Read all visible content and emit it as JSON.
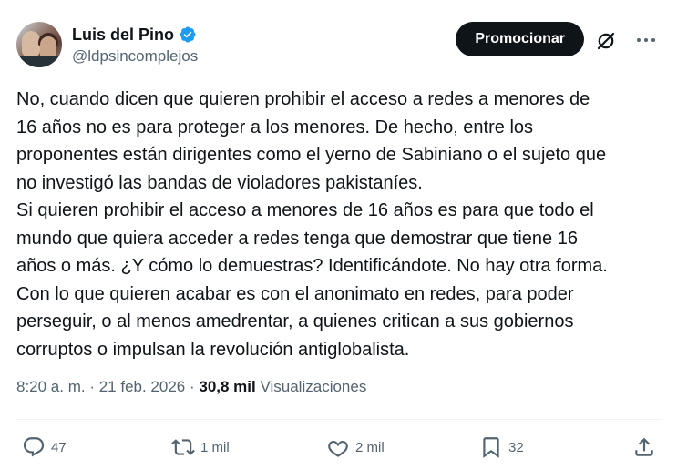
{
  "author": {
    "display_name": "Luis del Pino",
    "handle": "@ldpsincomplejos",
    "verified": true
  },
  "header": {
    "promote_label": "Promocionar",
    "grok_icon": "grok-icon",
    "more_icon": "more-dots-icon"
  },
  "tweet": {
    "paragraph_1": "No, cuando dicen que quieren prohibir el acceso a redes a menores de\n16 años no es para proteger a los menores. De hecho, entre los\nproponentes están dirigentes como el yerno de Sabiniano o el sujeto que\nno investigó las bandas de violadores pakistaníes.",
    "paragraph_2": "Si quieren prohibir el acceso a menores de 16 años es para que todo el\nmundo que quiera acceder a redes tenga que demostrar que tiene 16\naños o más. ¿Y cómo lo demuestras? Identificándote. No hay otra forma.",
    "paragraph_3": "Con lo que quieren acabar es con el anonimato en redes, para poder\nperseguir, o al menos amedrentar, a quienes critican a sus gobiernos\ncorruptos o impulsan la revolución antiglobalista."
  },
  "meta": {
    "time": "8:20 a. m.",
    "separator": " · ",
    "date": "21 feb. 2026",
    "views_count": "30,8 mil",
    "views_label": "Visualizaciones"
  },
  "actions": {
    "replies": "47",
    "reposts": "1 mil",
    "likes": "2 mil",
    "bookmarks": "32"
  },
  "colors": {
    "text": "#0f1419",
    "secondary": "#536471",
    "verified": "#1d9bf0",
    "button_bg": "#0f1419"
  }
}
